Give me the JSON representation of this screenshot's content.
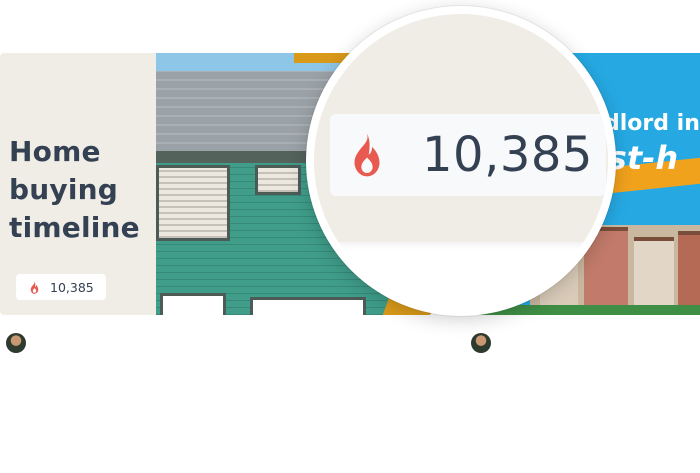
{
  "cards": [
    {
      "title_lines": [
        "Home",
        "buying",
        "timeline"
      ],
      "view_count": "10,385",
      "count_icon": "fire-icon",
      "accent_color": "#d99a1a"
    },
    {
      "headline_line1": "dlord ins",
      "headline_line2": "ust-h",
      "background_color": "#26a9e3"
    }
  ],
  "magnifier": {
    "count_icon": "fire-icon",
    "view_count": "10,385"
  },
  "colors": {
    "fire": "#e85a4f",
    "text": "#344152",
    "panel": "#f0ede6"
  }
}
